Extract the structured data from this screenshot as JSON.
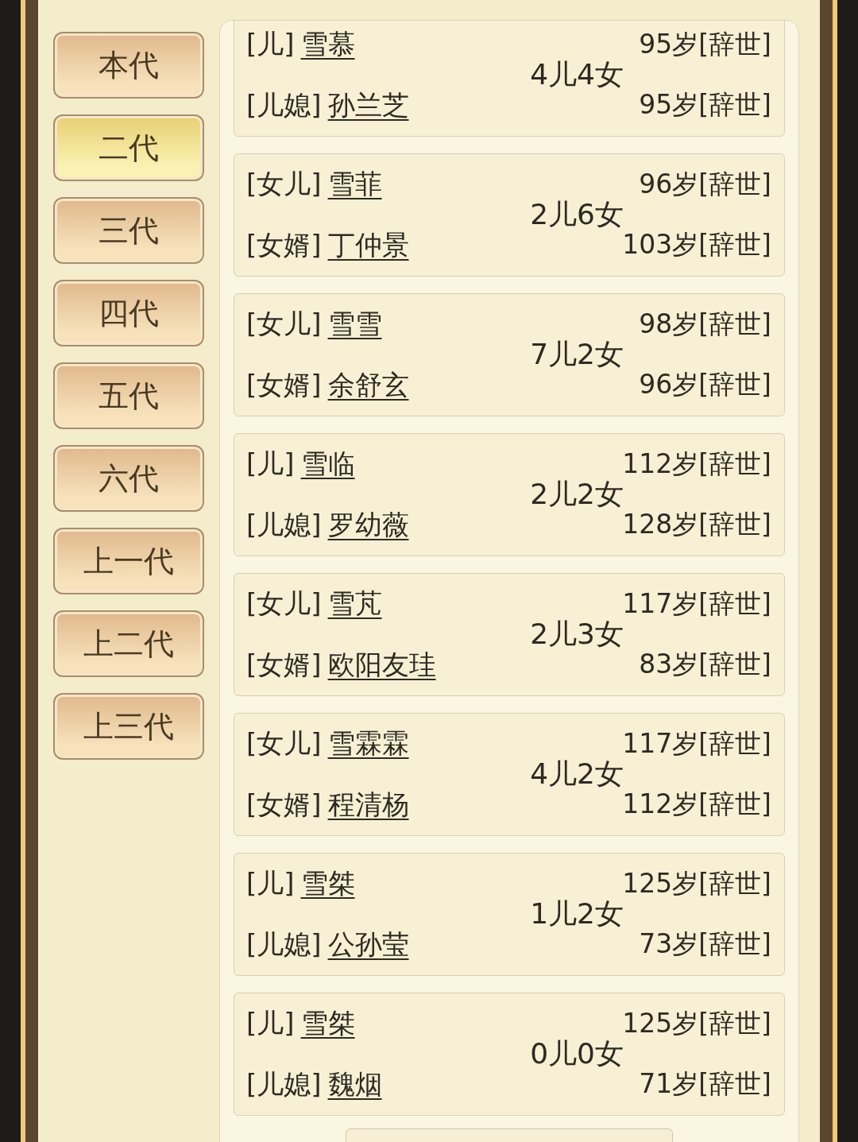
{
  "generations": [
    {
      "label": "本代",
      "selected": false
    },
    {
      "label": "二代",
      "selected": true
    },
    {
      "label": "三代",
      "selected": false
    },
    {
      "label": "四代",
      "selected": false
    },
    {
      "label": "五代",
      "selected": false
    },
    {
      "label": "六代",
      "selected": false
    },
    {
      "label": "上一代",
      "selected": false
    },
    {
      "label": "上二代",
      "selected": false
    },
    {
      "label": "上三代",
      "selected": false
    }
  ],
  "members": [
    {
      "relation": "[儿]",
      "name": "雪慕",
      "spouse_relation": "[儿媳]",
      "spouse_name": "孙兰芝",
      "children": "4儿4女",
      "age": "95岁[辞世]",
      "spouse_age": "95岁[辞世]"
    },
    {
      "relation": "[女儿]",
      "name": "雪菲",
      "spouse_relation": "[女婿]",
      "spouse_name": "丁仲景",
      "children": "2儿6女",
      "age": "96岁[辞世]",
      "spouse_age": "103岁[辞世]"
    },
    {
      "relation": "[女儿]",
      "name": "雪雪",
      "spouse_relation": "[女婿]",
      "spouse_name": "余舒玄",
      "children": "7儿2女",
      "age": "98岁[辞世]",
      "spouse_age": "96岁[辞世]"
    },
    {
      "relation": "[儿]",
      "name": "雪临",
      "spouse_relation": "[儿媳]",
      "spouse_name": "罗幼薇",
      "children": "2儿2女",
      "age": "112岁[辞世]",
      "spouse_age": "128岁[辞世]"
    },
    {
      "relation": "[女儿]",
      "name": "雪芃",
      "spouse_relation": "[女婿]",
      "spouse_name": "欧阳友珪",
      "children": "2儿3女",
      "age": "117岁[辞世]",
      "spouse_age": "83岁[辞世]"
    },
    {
      "relation": "[女儿]",
      "name": "雪霖霖",
      "spouse_relation": "[女婿]",
      "spouse_name": "程清杨",
      "children": "4儿2女",
      "age": "117岁[辞世]",
      "spouse_age": "112岁[辞世]"
    },
    {
      "relation": "[儿]",
      "name": "雪桀",
      "spouse_relation": "[儿媳]",
      "spouse_name": "公孙莹",
      "children": "1儿2女",
      "age": "125岁[辞世]",
      "spouse_age": "73岁[辞世]"
    },
    {
      "relation": "[儿]",
      "name": "雪桀",
      "spouse_relation": "[儿媳]",
      "spouse_name": "魏烟",
      "children": "0儿0女",
      "age": "125岁[辞世]",
      "spouse_age": "71岁[辞世]"
    }
  ]
}
